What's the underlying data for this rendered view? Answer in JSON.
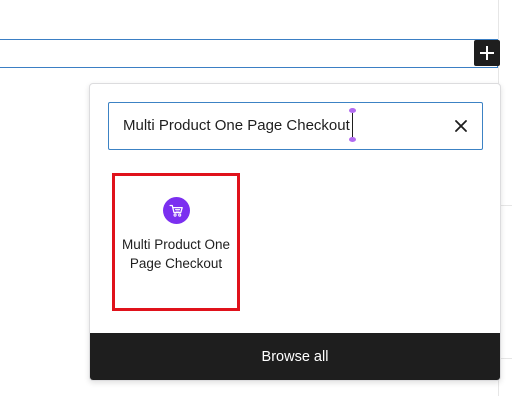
{
  "toolbar": {
    "inserter_icon": "plus-icon"
  },
  "inserter": {
    "search": {
      "value": "Multi Product One Page Checkout",
      "clear_icon": "close-icon"
    },
    "results": [
      {
        "title": "Multi Product One Page Checkout",
        "icon": "cart-icon",
        "icon_color": "#7b2ff0",
        "highlight_color": "#e0121b"
      }
    ],
    "browse_all_label": "Browse all"
  },
  "colors": {
    "accent": "#3c82c4",
    "dark": "#1e1e1e",
    "caret_handle": "#b26bf0"
  }
}
